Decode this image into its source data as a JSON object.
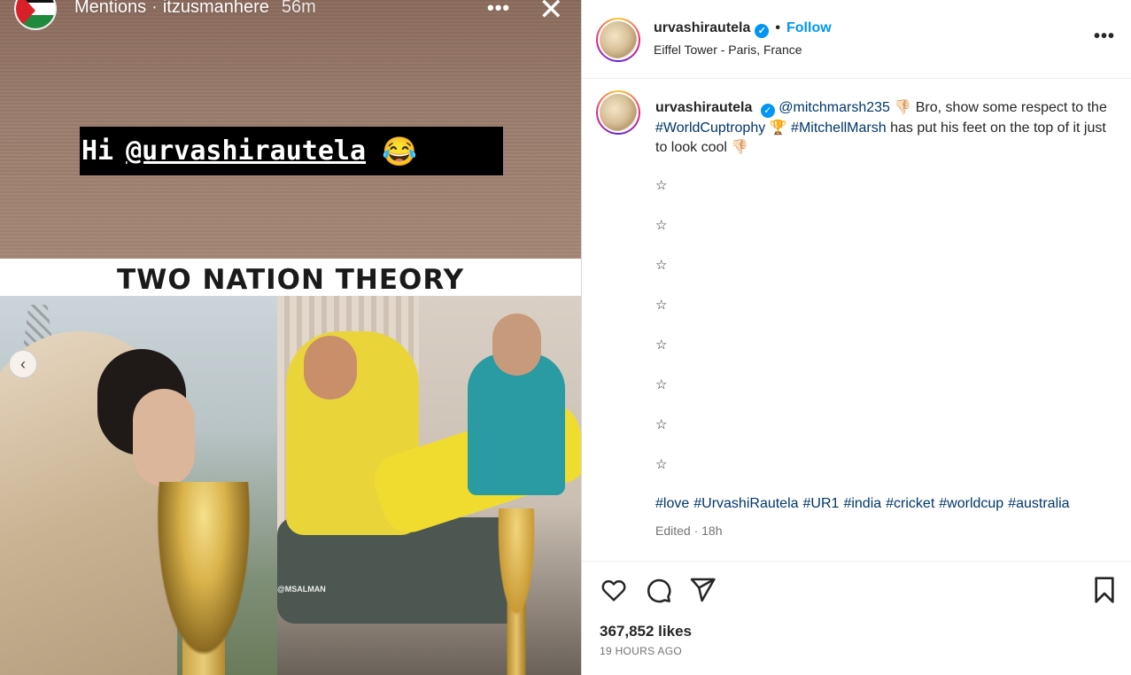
{
  "story": {
    "header_section": "Mentions",
    "header_user": "itzusmanhere",
    "header_time": "56m",
    "more_glyph": "•••",
    "close_glyph": "✕",
    "sticker_prefix": "Hi",
    "sticker_mention": "@urvashirautela",
    "sticker_emoji": "😂",
    "meme_title": "TWO NATION THEORY",
    "watermark": "@MSALMAN",
    "prev_glyph": "‹",
    "flag_icon": "palestine-flag-avatar"
  },
  "post": {
    "username": "urvashirautela",
    "verified_glyph": "✓",
    "separator": "•",
    "follow_label": "Follow",
    "location": "Eiffel Tower - Paris, France",
    "more_glyph": "•••",
    "caption": {
      "username": "urvashirautela",
      "mention": "@mitchmarsh235",
      "emoji_thumb": "👎🏻",
      "text1": "Bro, show some respect to the",
      "hashtag1": "#WorldCuptrophy",
      "emoji_trophy": "🏆",
      "hashtag2": "#MitchellMarsh",
      "text2": "has put his feet on the top of it just to look cool",
      "emoji_thumb_end": "👎🏻"
    },
    "stars": [
      "☆",
      "☆",
      "☆",
      "☆",
      "☆",
      "☆",
      "☆",
      "☆"
    ],
    "hashtags": [
      "#love",
      "#UrvashiRautela",
      "#UR1",
      "#india",
      "#cricket",
      "#worldcup",
      "#australia"
    ],
    "edited": "Edited · 18h",
    "likes": "367,852 likes",
    "time_ago": "19 HOURS AGO"
  },
  "icons": {
    "like": "heart-icon",
    "comment": "comment-icon",
    "share": "send-icon",
    "save": "bookmark-icon"
  },
  "colors": {
    "link": "#00376b",
    "follow": "#0095f6",
    "muted": "#737373"
  }
}
